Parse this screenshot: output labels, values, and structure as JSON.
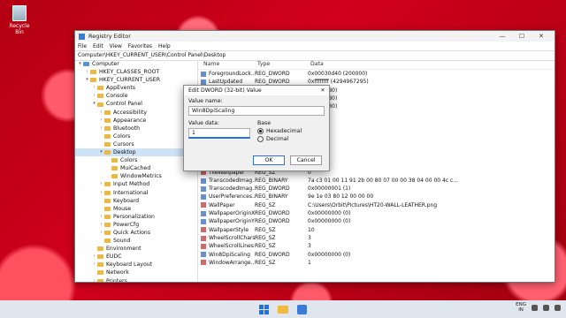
{
  "desktop": {
    "recycle_label": "Recycle Bin"
  },
  "window": {
    "title": "Registry Editor",
    "menu": [
      "File",
      "Edit",
      "View",
      "Favorites",
      "Help"
    ],
    "address": "Computer\\HKEY_CURRENT_USER\\Control Panel\\Desktop",
    "controls": [
      "—",
      "☐",
      "✕"
    ]
  },
  "tree": [
    {
      "label": "Computer",
      "depth": 0,
      "arrow": "▾",
      "selected": false
    },
    {
      "label": "HKEY_CLASSES_ROOT",
      "depth": 1,
      "arrow": "›",
      "selected": false
    },
    {
      "label": "HKEY_CURRENT_USER",
      "depth": 1,
      "arrow": "▾",
      "selected": false
    },
    {
      "label": "AppEvents",
      "depth": 2,
      "arrow": "›",
      "selected": false
    },
    {
      "label": "Console",
      "depth": 2,
      "arrow": "›",
      "selected": false
    },
    {
      "label": "Control Panel",
      "depth": 2,
      "arrow": "▾",
      "selected": false
    },
    {
      "label": "Accessibility",
      "depth": 3,
      "arrow": "›",
      "selected": false
    },
    {
      "label": "Appearance",
      "depth": 3,
      "arrow": "›",
      "selected": false
    },
    {
      "label": "Bluetooth",
      "depth": 3,
      "arrow": "›",
      "selected": false
    },
    {
      "label": "Colors",
      "depth": 3,
      "arrow": "",
      "selected": false
    },
    {
      "label": "Cursors",
      "depth": 3,
      "arrow": "",
      "selected": false
    },
    {
      "label": "Desktop",
      "depth": 3,
      "arrow": "▾",
      "selected": true
    },
    {
      "label": "Colors",
      "depth": 4,
      "arrow": "",
      "selected": false
    },
    {
      "label": "MuiCached",
      "depth": 4,
      "arrow": "",
      "selected": false
    },
    {
      "label": "WindowMetrics",
      "depth": 4,
      "arrow": "",
      "selected": false
    },
    {
      "label": "Input Method",
      "depth": 3,
      "arrow": "›",
      "selected": false
    },
    {
      "label": "International",
      "depth": 3,
      "arrow": "›",
      "selected": false
    },
    {
      "label": "Keyboard",
      "depth": 3,
      "arrow": "",
      "selected": false
    },
    {
      "label": "Mouse",
      "depth": 3,
      "arrow": "",
      "selected": false
    },
    {
      "label": "Personalization",
      "depth": 3,
      "arrow": "›",
      "selected": false
    },
    {
      "label": "PowerCfg",
      "depth": 3,
      "arrow": "›",
      "selected": false
    },
    {
      "label": "Quick Actions",
      "depth": 3,
      "arrow": "›",
      "selected": false
    },
    {
      "label": "Sound",
      "depth": 3,
      "arrow": "",
      "selected": false
    },
    {
      "label": "Environment",
      "depth": 2,
      "arrow": "",
      "selected": false
    },
    {
      "label": "EUDC",
      "depth": 2,
      "arrow": "›",
      "selected": false
    },
    {
      "label": "Keyboard Layout",
      "depth": 2,
      "arrow": "›",
      "selected": false
    },
    {
      "label": "Network",
      "depth": 2,
      "arrow": "",
      "selected": false
    },
    {
      "label": "Printers",
      "depth": 2,
      "arrow": "›",
      "selected": false
    }
  ],
  "columns": {
    "name": "Name",
    "type": "Type",
    "data": "Data"
  },
  "values": [
    {
      "name": "ForegroundLock...",
      "type": "REG_DWORD",
      "data": "0x00030d40 (200000)",
      "kind": "bin"
    },
    {
      "name": "LastUpdated",
      "type": "REG_DWORD",
      "data": "0xffffffff (4294967295)",
      "kind": "bin"
    },
    {
      "name": "",
      "type": "",
      "data": "500 (1280)",
      "kind": ""
    },
    {
      "name": "",
      "type": "",
      "data": "500 (1280)",
      "kind": ""
    },
    {
      "name": "",
      "type": "",
      "data": "500 (1280)",
      "kind": ""
    },
    {
      "name": "",
      "type": "",
      "data": "",
      "kind": ""
    },
    {
      "name": "",
      "type": "",
      "data": "002 (2)",
      "kind": ""
    },
    {
      "name": "",
      "type": "",
      "data": "000 (0)",
      "kind": ""
    },
    {
      "name": "",
      "type": "",
      "data": "",
      "kind": ""
    },
    {
      "name": "",
      "type": "",
      "data": "",
      "kind": ""
    },
    {
      "name": "",
      "type": "",
      "data": "",
      "kind": ""
    },
    {
      "name": "",
      "type": "",
      "data": "",
      "kind": ""
    },
    {
      "name": "TileWallpaper",
      "type": "REG_SZ",
      "data": "0",
      "kind": "sz"
    },
    {
      "name": "TranscodedImag...",
      "type": "REG_BINARY",
      "data": "7a c3 01 00 11 91 2b 00 80 07 00 00 38 04 00 00 4c c...",
      "kind": "bin"
    },
    {
      "name": "TranscodedImag...",
      "type": "REG_DWORD",
      "data": "0x00000001 (1)",
      "kind": "bin"
    },
    {
      "name": "UserPreferences...",
      "type": "REG_BINARY",
      "data": "9e 1e 03 80 12 00 00 00",
      "kind": "bin"
    },
    {
      "name": "WallPaper",
      "type": "REG_SZ",
      "data": "C:\\Users\\Orbit\\Pictures\\HT20-WALL-LEATHER.png",
      "kind": "sz"
    },
    {
      "name": "WallpaperOriginX",
      "type": "REG_DWORD",
      "data": "0x00000000 (0)",
      "kind": "bin"
    },
    {
      "name": "WallpaperOriginY",
      "type": "REG_DWORD",
      "data": "0x00000000 (0)",
      "kind": "bin"
    },
    {
      "name": "WallpaperStyle",
      "type": "REG_SZ",
      "data": "10",
      "kind": "sz"
    },
    {
      "name": "WheelScrollChars",
      "type": "REG_SZ",
      "data": "3",
      "kind": "sz"
    },
    {
      "name": "WheelScrollLines",
      "type": "REG_SZ",
      "data": "3",
      "kind": "sz"
    },
    {
      "name": "Win8DpiScaling",
      "type": "REG_DWORD",
      "data": "0x00000000 (0)",
      "kind": "bin"
    },
    {
      "name": "WindowArrange...",
      "type": "REG_SZ",
      "data": "1",
      "kind": "sz"
    }
  ],
  "dialog": {
    "title": "Edit DWORD (32-bit) Value",
    "close": "✕",
    "value_name_label": "Value name:",
    "value_name": "Win8DpiScaling",
    "value_data_label": "Value data:",
    "value_data": "1",
    "base_label": "Base",
    "hex_label": "Hexadecimal",
    "dec_label": "Decimal",
    "base_selected": "hex",
    "ok": "OK",
    "cancel": "Cancel"
  },
  "taskbar": {
    "lang_top": "ENG",
    "lang_bottom": "IN"
  }
}
